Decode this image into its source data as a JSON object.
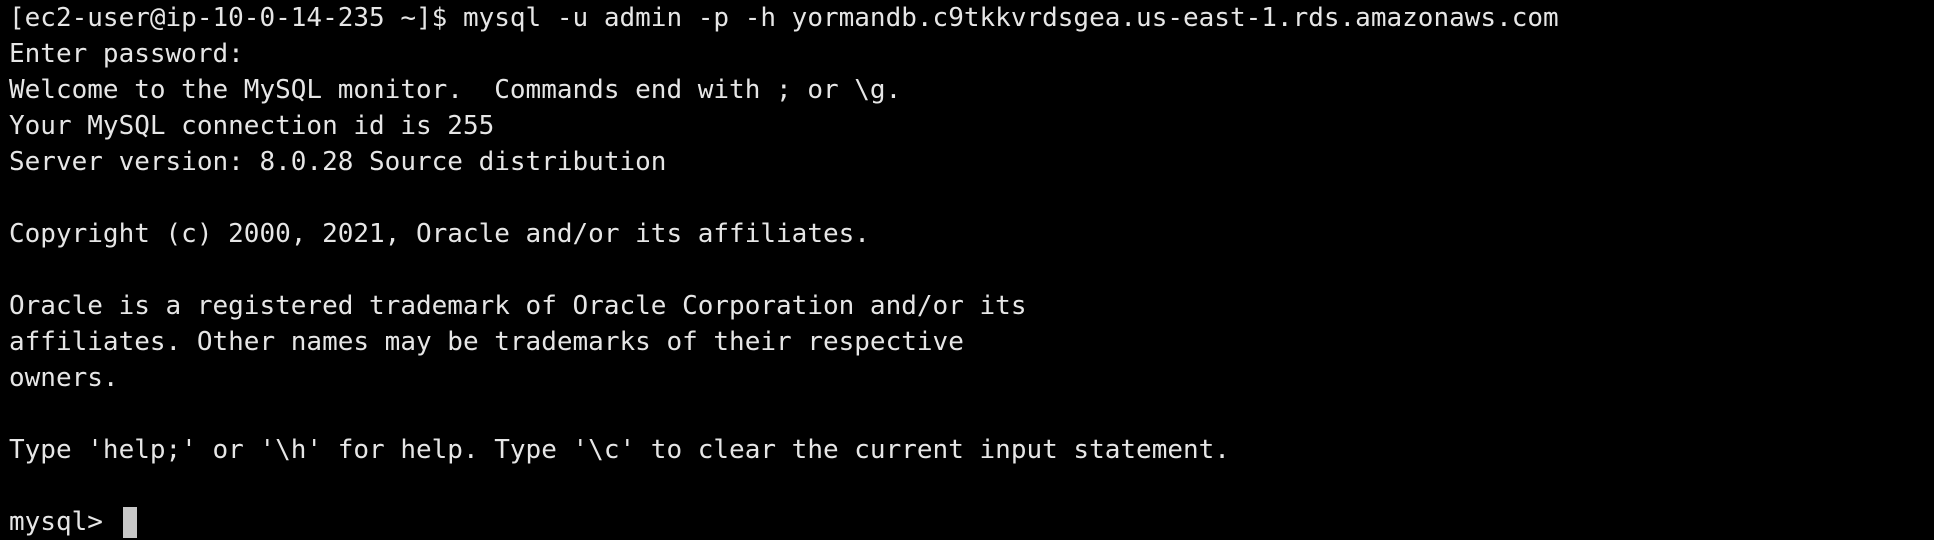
{
  "terminal": {
    "lines": [
      "[ec2-user@ip-10-0-14-235 ~]$ mysql -u admin -p -h yormandb.c9tkkvrdsgea.us-east-1.rds.amazonaws.com",
      "Enter password:",
      "Welcome to the MySQL monitor.  Commands end with ; or \\g.",
      "Your MySQL connection id is 255",
      "Server version: 8.0.28 Source distribution",
      "",
      "Copyright (c) 2000, 2021, Oracle and/or its affiliates.",
      "",
      "Oracle is a registered trademark of Oracle Corporation and/or its",
      "affiliates. Other names may be trademarks of their respective",
      "owners.",
      "",
      "Type 'help;' or '\\h' for help. Type '\\c' to clear the current input statement.",
      ""
    ],
    "prompt": "mysql> ",
    "input_value": ""
  }
}
